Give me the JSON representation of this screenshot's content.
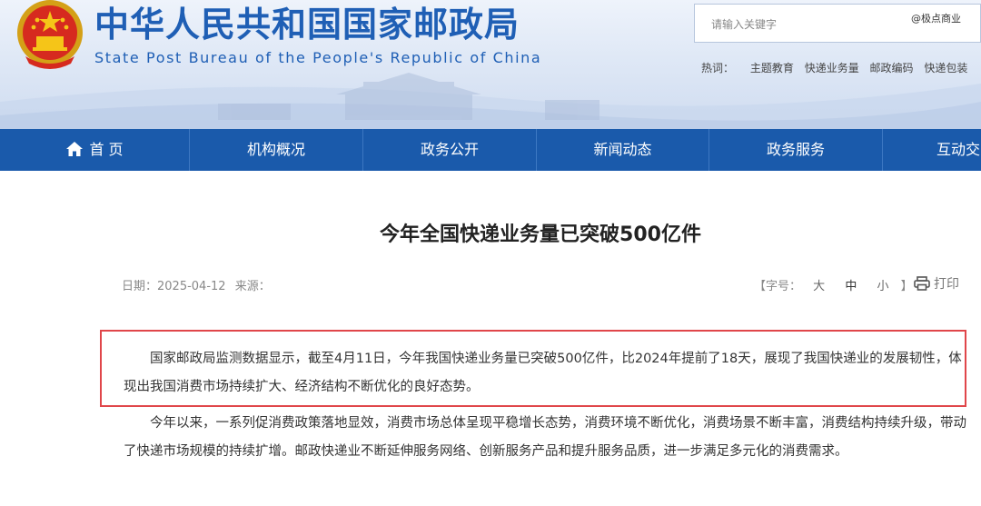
{
  "header": {
    "title": "中华人民共和国国家邮政局",
    "subtitle": "State Post Bureau of the People's Republic of China",
    "search_placeholder": "请输入关键字",
    "watermark": "@极点商业",
    "hotwords_label": "热词：",
    "hotwords": [
      "主题教育",
      "快递业务量",
      "邮政编码",
      "快递包装"
    ]
  },
  "nav": {
    "items": [
      "首 页",
      "机构概况",
      "政务公开",
      "新闻动态",
      "政务服务",
      "互动交"
    ]
  },
  "article": {
    "title": "今年全国快递业务量已突破500亿件",
    "date_label": "日期：2025-04-12",
    "source_label": "来源：",
    "fontsize_label": "【字号：",
    "fontsize_large": "大",
    "fontsize_medium": "中",
    "fontsize_small": "小",
    "fontsize_end": "】",
    "print_label": "打印",
    "paragraph1": "国家邮政局监测数据显示，截至4月11日，今年我国快递业务量已突破500亿件，比2024年提前了18天，展现了我国快递业的发展韧性，体现出我国消费市场持续扩大、经济结构不断优化的良好态势。",
    "paragraph2": "今年以来，一系列促消费政策落地显效，消费市场总体呈现平稳增长态势，消费环境不断优化，消费场景不断丰富，消费结构持续升级，带动了快递市场规模的持续扩增。邮政快递业不断延伸服务网络、创新服务产品和提升服务品质，进一步满足多元化的消费需求。"
  },
  "colors": {
    "brand_blue": "#1a5aab",
    "highlight_red": "#e0464a"
  }
}
